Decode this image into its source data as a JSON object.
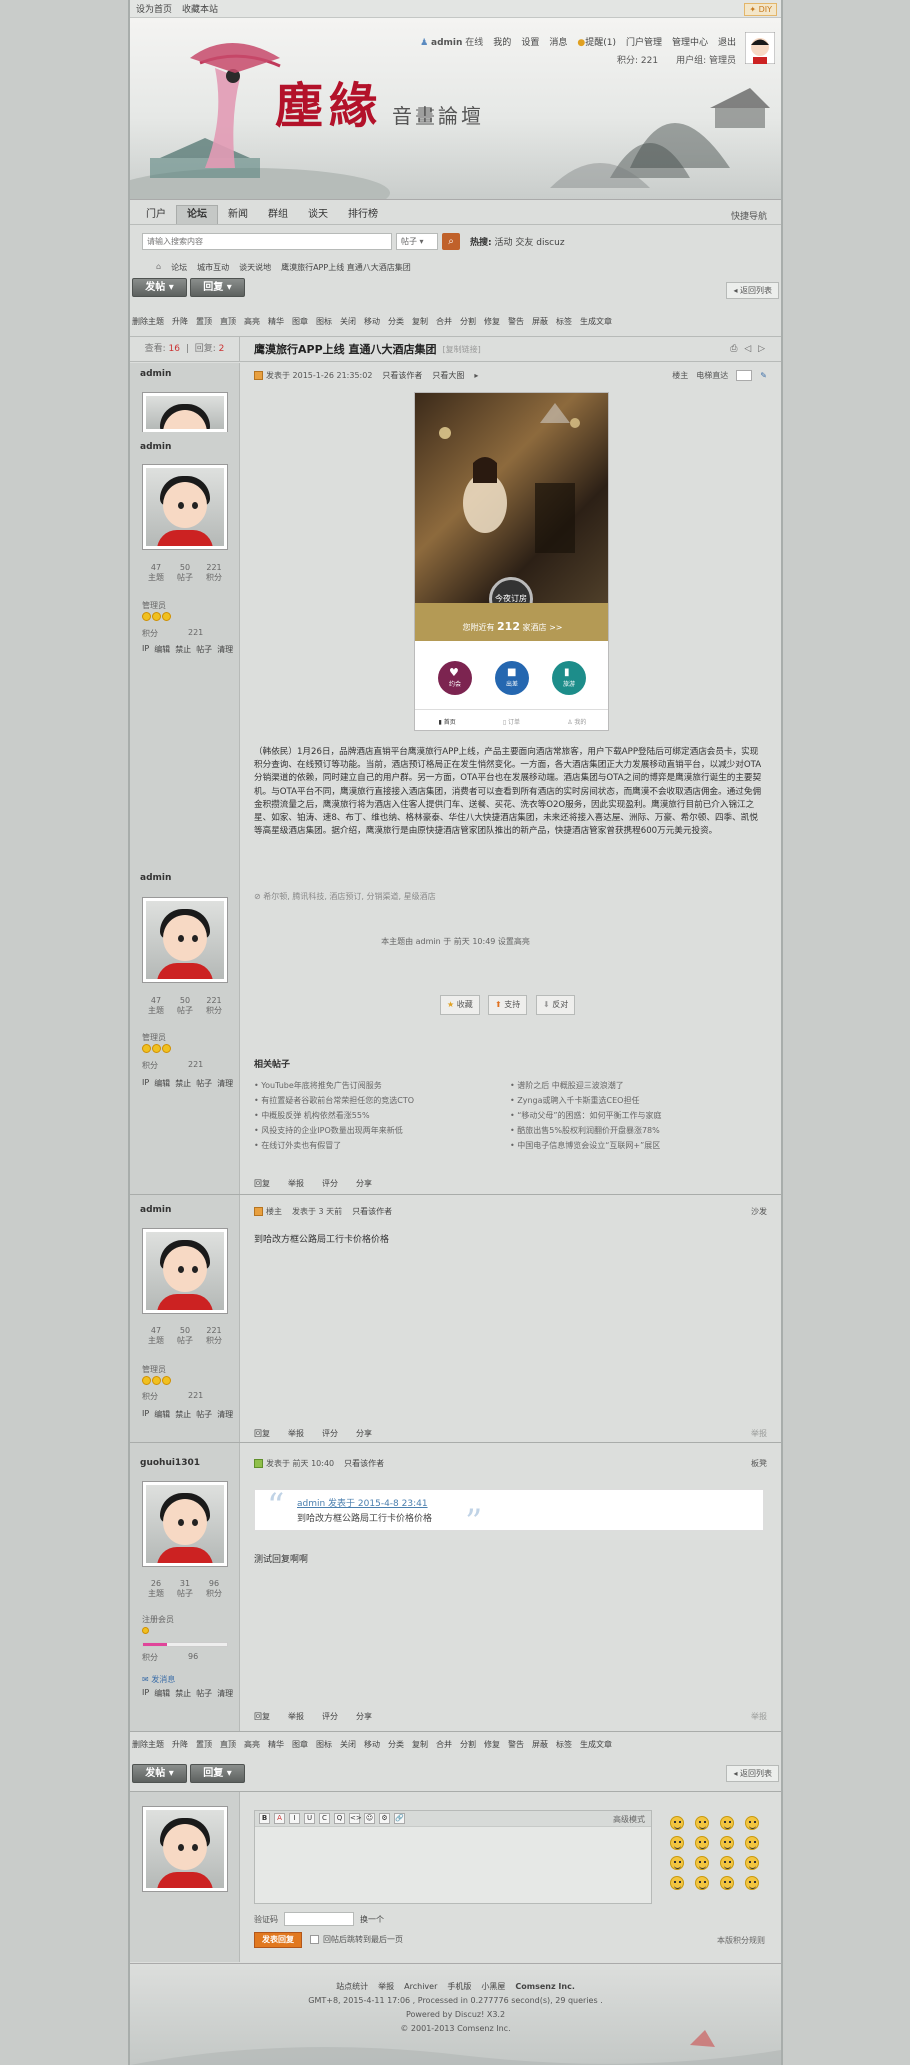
{
  "topbar": {
    "links": [
      "设为首页",
      "收藏本站"
    ],
    "diy": "DIY"
  },
  "banner": {
    "logo": "塵緣",
    "subtitle": "音畫論壇"
  },
  "user": {
    "name": "admin",
    "status": "在线",
    "links": [
      "我的",
      "设置",
      "消息",
      "提醒(1)",
      "门户管理",
      "管理中心",
      "退出"
    ],
    "points": "积分: 221",
    "group": "用户组: 管理员"
  },
  "nav": {
    "tabs": [
      "门户",
      "论坛",
      "新闻",
      "群组",
      "谈天",
      "排行榜"
    ],
    "active": 1,
    "quick": "快捷导航"
  },
  "search": {
    "placeholder": "请输入搜索内容",
    "select": "帖子",
    "hot_label": "热搜:",
    "hot": [
      "活动",
      "交友",
      "discuz"
    ]
  },
  "breadcrumb": [
    "论坛",
    "城市互动",
    "谈天说地",
    "鹰漠旅行APP上线 直通八大酒店集团"
  ],
  "buttons": {
    "post": "发帖",
    "reply": "回复",
    "back": "返回列表"
  },
  "modbar": [
    "删除主题",
    "升降",
    "置顶",
    "直顶",
    "高亮",
    "精华",
    "图章",
    "图标",
    "关闭",
    "移动",
    "分类",
    "复制",
    "合并",
    "分割",
    "修复",
    "警告",
    "屏蔽",
    "标签",
    "生成文章"
  ],
  "thread": {
    "views_label": "查看:",
    "views": "16",
    "replies_label": "回复:",
    "replies": "2",
    "title": "鹰漠旅行APP上线 直通八大酒店集团",
    "copy": "[复制链接]"
  },
  "post1": {
    "author": "admin",
    "time": "发表于 2015-1-26 21:35:02",
    "only": "只看该作者",
    "bigpic": "只看大图",
    "floor": "楼主",
    "jump": "电梯直达",
    "stats": [
      {
        "v": "47",
        "l": "主题"
      },
      {
        "v": "50",
        "l": "帖子"
      },
      {
        "v": "221",
        "l": "积分"
      }
    ],
    "group": "管理员",
    "credit_label": "积分",
    "credit": "221",
    "ops": [
      "IP",
      "编辑",
      "禁止",
      "帖子",
      "清理"
    ],
    "app": {
      "order": "今夜订房",
      "count_pre": "您附近有",
      "count": "212",
      "count_post": "家酒店 >>",
      "icons": [
        "约会",
        "出差",
        "旅游"
      ],
      "nav": [
        "首页",
        "订单",
        "我的"
      ]
    },
    "content": "（韩依民）1月26日，品牌酒店直销平台鹰漠旅行APP上线，产品主要面向酒店常旅客，用户下载APP登陆后可绑定酒店会员卡，实现积分查询、在线预订等功能。当前，酒店预订格局正在发生悄然变化。一方面，各大酒店集团正大力发展移动直销平台，以减少对OTA分销渠道的依赖，同时建立自己的用户群。另一方面，OTA平台也在发展移动端。酒店集团与OTA之间的博弈是鹰漠旅行诞生的主要契机。与OTA平台不同，鹰漠旅行直接接入酒店集团，消费者可以查看到所有酒店的实时房间状态，而鹰漠不会收取酒店佣金。通过免佣金积攒流量之后，鹰漠旅行将为酒店入住客人提供门车、送餐、买花、洗衣等O2O服务，因此实现盈利。鹰漠旅行目前已介入锦江之星、如家、铂涛、速8、布丁、维也纳、格林豪泰、华住八大快捷酒店集团，未来还将接入喜达屋、洲际、万豪、希尔顿、四季、凯悦等高星级酒店集团。据介绍，鹰漠旅行是由原快捷酒店管家团队推出的新产品，快捷酒店管家曾获携程600万元美元投资。",
    "tags": "希尔顿, 腾讯科技, 酒店预订, 分销渠道, 星级酒店",
    "modnote": "本主题由 admin 于 前天 10:49 设置高亮",
    "actions": [
      "收藏",
      "支持",
      "反对"
    ],
    "related_title": "相关帖子",
    "related": [
      "YouTube年底将推免广告订阅服务",
      "有拉置疑者谷歌前台常荣担任您的竞选CTO",
      "中概股反弹 机构依然看涨55%",
      "风投支持的企业IPO数量出现两年来新低",
      "在线订外卖也有假冒了",
      "谱阶之后 中概股迎三波浪潮了",
      "Zynga或聘入千卡斯重选CEO担任",
      "“移动父母”的困惑：如何平衡工作与家庭",
      "酷旅出售5%股权利润翻价开盘暴涨78%",
      "中国电子信息博览会设立“互联网+”展区"
    ],
    "foot": [
      "回复",
      "举报",
      "评分",
      "分享"
    ]
  },
  "post2": {
    "author": "admin",
    "floor_label": "楼主",
    "time": "发表于 3 天前",
    "only": "只看该作者",
    "floor": "沙发",
    "text": "到哈改方框公路局工行卡价格价格",
    "stats": [
      {
        "v": "47",
        "l": "主题"
      },
      {
        "v": "50",
        "l": "帖子"
      },
      {
        "v": "221",
        "l": "积分"
      }
    ],
    "group": "管理员",
    "credit_label": "积分",
    "credit": "221",
    "ops": [
      "IP",
      "编辑",
      "禁止",
      "帖子",
      "清理"
    ],
    "foot": [
      "回复",
      "举报",
      "评分",
      "分享",
      "举报"
    ]
  },
  "post3": {
    "author": "guohui1301",
    "time": "发表于 前天 10:40",
    "only": "只看该作者",
    "floor": "板凳",
    "quote_author": "admin 发表于 2015-4-8 23:41",
    "quote_text": "到哈改方框公路局工行卡价格价格",
    "text": "测试回复啊啊",
    "stats": [
      {
        "v": "26",
        "l": "主题"
      },
      {
        "v": "31",
        "l": "帖子"
      },
      {
        "v": "96",
        "l": "积分"
      }
    ],
    "group": "注册会员",
    "credit_label": "积分",
    "credit": "96",
    "msg": "发消息",
    "ops": [
      "IP",
      "编辑",
      "禁止",
      "帖子",
      "清理"
    ],
    "progress": 0.28,
    "foot": [
      "回复",
      "举报",
      "评分",
      "分享",
      "举报"
    ]
  },
  "editor": {
    "mode": "高级模式",
    "captcha_label": "验证码",
    "captcha_change": "换一个",
    "submit": "发表回复",
    "checkbox": "回帖后跳转到最后一页",
    "rules": "本版积分规则",
    "tools": [
      "B",
      "A",
      "I",
      "U",
      "C",
      "Q",
      "<>",
      "☺",
      "⚙",
      "🔗"
    ]
  },
  "footer": {
    "links": [
      "站点统计",
      "举报",
      "Archiver",
      "手机版",
      "小黑屋",
      "Comsenz Inc."
    ],
    "line2": "GMT+8, 2015-4-11 17:06 , Processed in 0.277776 second(s), 29 queries .",
    "line3": "Powered by Discuz! X3.2",
    "line4": "© 2001-2013 Comsenz Inc."
  }
}
